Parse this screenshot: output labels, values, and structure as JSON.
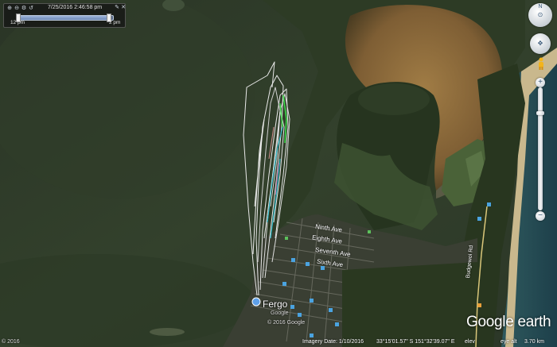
{
  "time_slider": {
    "date_label": "7/25/2016",
    "time_label": "2:46:58 pm",
    "start_label": "12 pm",
    "end_label": "2 pm",
    "progress": 0.96
  },
  "map_labels": {
    "town": "Fergo",
    "town_sub": "Google",
    "streets": [
      "Ninth Ave",
      "Eighth Ave",
      "Seventh Ave",
      "Sixth Ave",
      "Budgewoi Rd"
    ],
    "copyright_inline": "© 2016 Google",
    "copyright_corner": "© 2016"
  },
  "status_bar": {
    "imagery_date": "Imagery Date: 1/10/2016",
    "coordinates": "33°15'01.57\" S  151°32'39.07\" E",
    "elevation": "elev",
    "eye_alt": "eye alt",
    "eye_alt_value": "3.70 km"
  },
  "logo": {
    "text": "Google earth"
  },
  "nav_controls": {
    "look_icon": "compass-icon",
    "move_icon": "pan-icon",
    "pegman_icon": "street-view-icon",
    "zoom_in_icon": "plus-icon",
    "zoom_out_icon": "minus-icon"
  },
  "colors": {
    "water": "#2e3b29",
    "land": "#2f3f26",
    "sand": "#8c6a3a",
    "track_white": "#e9e9e9",
    "track_cyan": "#2fb6c4",
    "track_green": "#3cd84a"
  }
}
